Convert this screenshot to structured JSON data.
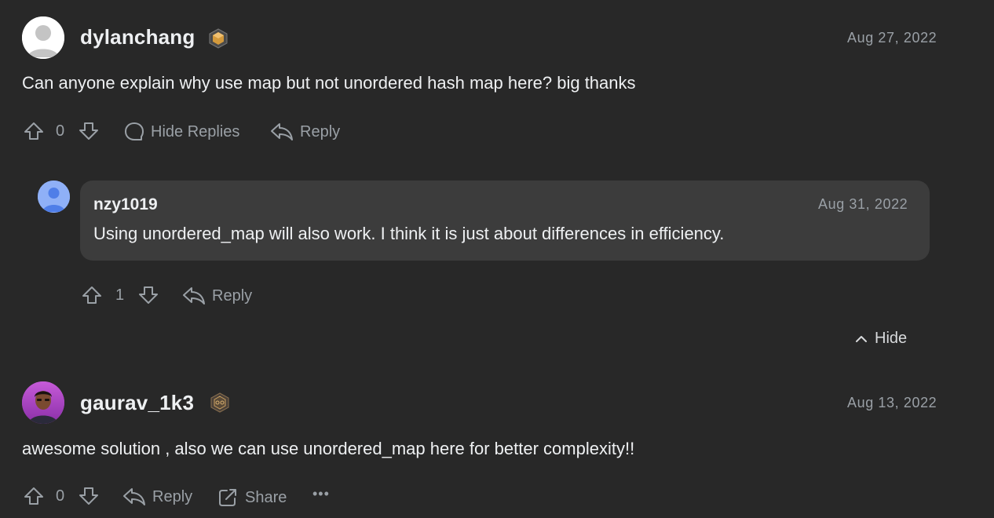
{
  "comments": [
    {
      "username": "dylanchang",
      "date": "Aug 27, 2022",
      "body": "Can anyone explain why use map but not unordered hash map here? big thanks",
      "votes": "0",
      "hide_replies_label": "Hide Replies",
      "reply_label": "Reply",
      "replies": [
        {
          "username": "nzy1019",
          "date": "Aug 31, 2022",
          "body": "Using unordered_map will also work. I think it is just about differences in efficiency.",
          "votes": "1",
          "reply_label": "Reply"
        }
      ],
      "hide_label": "Hide"
    },
    {
      "username": "gaurav_1k3",
      "date": "Aug 13, 2022",
      "body": "awesome solution , also we can use unordered_map here for better complexity!!",
      "votes": "0",
      "reply_label": "Reply",
      "share_label": "Share",
      "more_label": "•••"
    }
  ],
  "colors": {
    "background": "#282828",
    "bubble": "#3c3c3c",
    "text": "#eef0f2",
    "muted": "#9aa0a6",
    "avatar_blue": "#5b8cf0"
  },
  "icons": [
    "avatar-default-icon",
    "badge-icon",
    "upvote-icon",
    "downvote-icon",
    "comment-icon",
    "reply-icon",
    "share-icon",
    "more-icon",
    "chevron-up-icon"
  ]
}
